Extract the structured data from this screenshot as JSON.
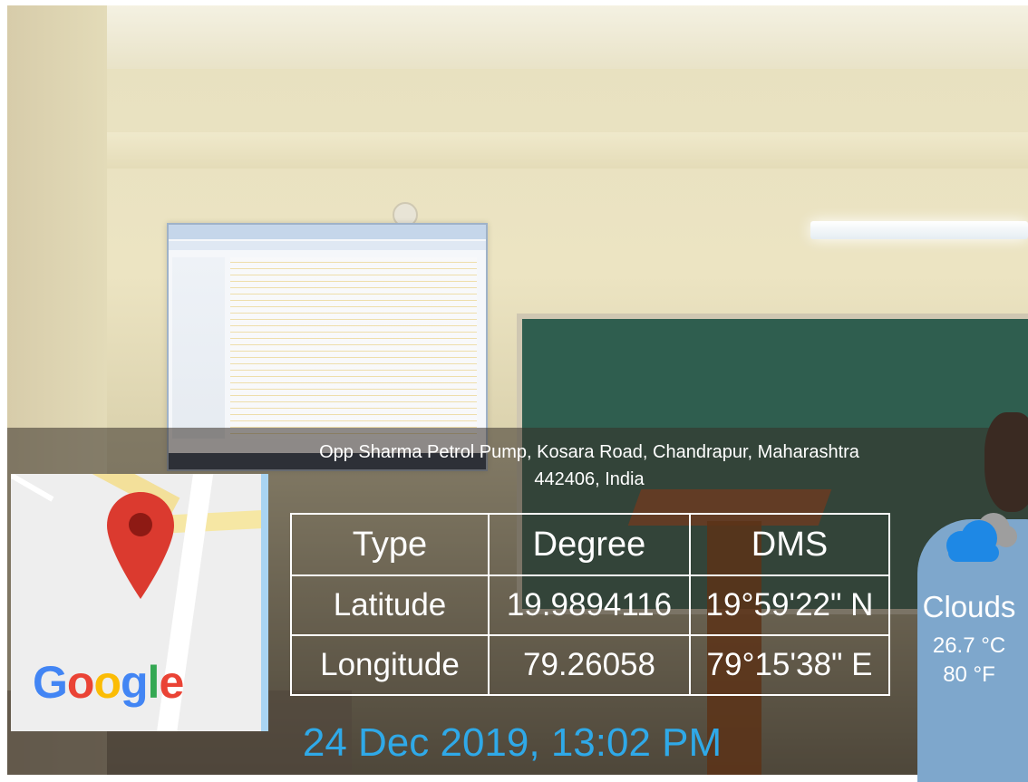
{
  "address": {
    "line1": "Opp Sharma Petrol Pump, Kosara Road, Chandrapur, Maharashtra",
    "line2": "442406, India"
  },
  "map": {
    "logo_parts": [
      {
        "char": "G",
        "color": "#4285F4"
      },
      {
        "char": "o",
        "color": "#EA4335"
      },
      {
        "char": "o",
        "color": "#FBBC05"
      },
      {
        "char": "g",
        "color": "#4285F4"
      },
      {
        "char": "l",
        "color": "#34A853"
      },
      {
        "char": "e",
        "color": "#EA4335"
      }
    ],
    "pin_icon": "map-pin-icon",
    "pin_color": "#DB3A2F"
  },
  "coords_table": {
    "headers": [
      "Type",
      "Degree",
      "DMS"
    ],
    "rows": [
      [
        "Latitude",
        "19.9894116",
        "19°59'22\" N"
      ],
      [
        "Longitude",
        "79.26058",
        "79°15'38\" E"
      ]
    ]
  },
  "weather": {
    "icon": "cloud-icon",
    "condition": "Clouds",
    "temp_c": "26.7 °C",
    "temp_f": "80 °F"
  },
  "datetime": "24 Dec 2019, 13:02 PM",
  "colors": {
    "datetime": "#2FA9E8",
    "cloud_front": "#1E88E5",
    "cloud_back": "#9E9E9E"
  }
}
